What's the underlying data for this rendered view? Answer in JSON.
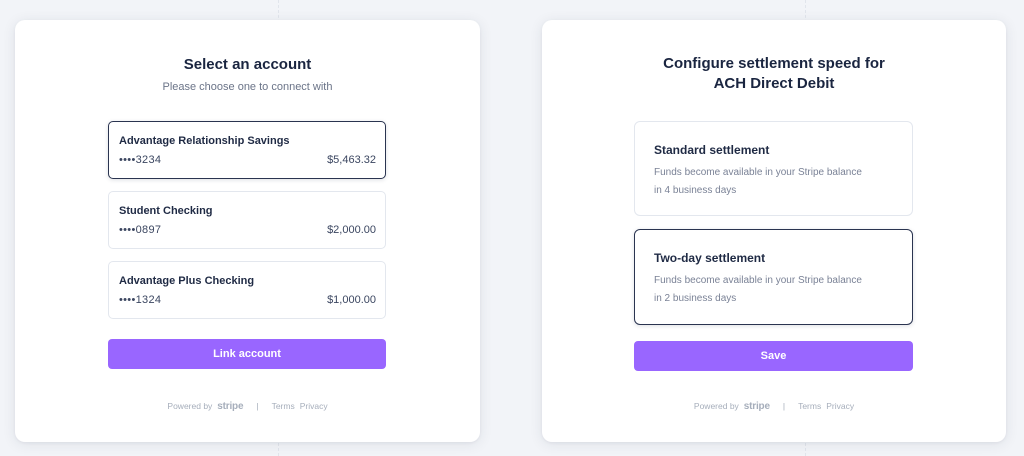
{
  "account_panel": {
    "title": "Select an account",
    "subtitle": "Please choose one to connect with",
    "accounts": [
      {
        "name": "Advantage Relationship Savings",
        "mask": "••••3234",
        "balance": "$5,463.32",
        "selected": true
      },
      {
        "name": "Student Checking",
        "mask": "••••0897",
        "balance": "$2,000.00",
        "selected": false
      },
      {
        "name": "Advantage Plus Checking",
        "mask": "••••1324",
        "balance": "$1,000.00",
        "selected": false
      }
    ],
    "button_label": "Link account"
  },
  "settlement_panel": {
    "title_line1": "Configure settlement speed for",
    "title_line2": "ACH Direct Debit",
    "options": [
      {
        "title": "Standard settlement",
        "description": "Funds become available in your Stripe balance in 4 business days",
        "selected": false
      },
      {
        "title": "Two-day settlement",
        "description": "Funds become available in your Stripe balance in 2 business days",
        "selected": true
      }
    ],
    "button_label": "Save"
  },
  "footer": {
    "powered_by": "Powered by",
    "brand": "stripe",
    "separator": "|",
    "terms": "Terms",
    "privacy": "Privacy"
  },
  "colors": {
    "accent": "#9966ff",
    "text_primary": "#1a2540",
    "selected_border": "#2a3450"
  }
}
